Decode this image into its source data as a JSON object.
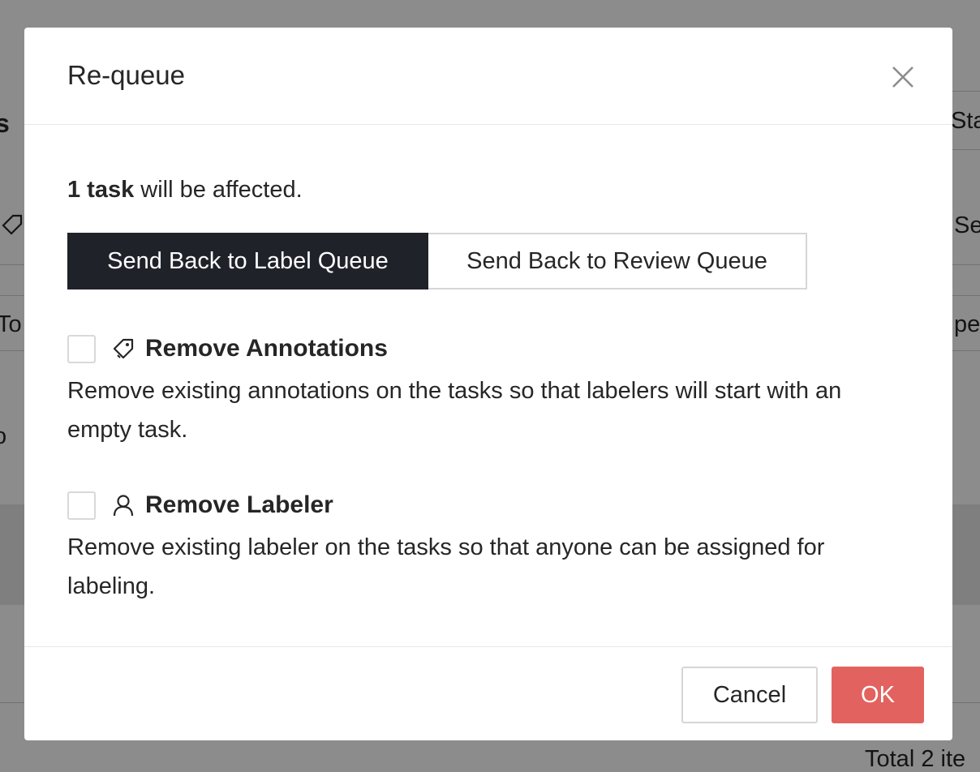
{
  "background": {
    "fragments": {
      "left_heading": "s",
      "right_status": "Sta",
      "right_select": "Se",
      "left_to": "To c",
      "right_pec": "pec",
      "left_o": "o",
      "footer_total": "Total 2 ite"
    }
  },
  "modal": {
    "title": "Re-queue",
    "close_icon": "close-icon",
    "affected": {
      "count_bold": "1 task",
      "suffix": " will be affected."
    },
    "queue_options": {
      "label_queue": "Send Back to Label Queue",
      "review_queue": "Send Back to Review Queue",
      "selected": "label_queue"
    },
    "options": [
      {
        "icon": "tag-icon",
        "title": "Remove Annotations",
        "description": "Remove existing annotations on the tasks so that labelers will start with an empty task.",
        "checked": false
      },
      {
        "icon": "user-icon",
        "title": "Remove Labeler",
        "description": "Remove existing labeler on the tasks so that anyone can be assigned for labeling.",
        "checked": false
      }
    ],
    "footer": {
      "cancel_label": "Cancel",
      "ok_label": "OK"
    }
  },
  "colors": {
    "primary_dark": "#1f2229",
    "ok_button": "#e2625f",
    "overlay": "rgba(0,0,0,0.45)"
  }
}
